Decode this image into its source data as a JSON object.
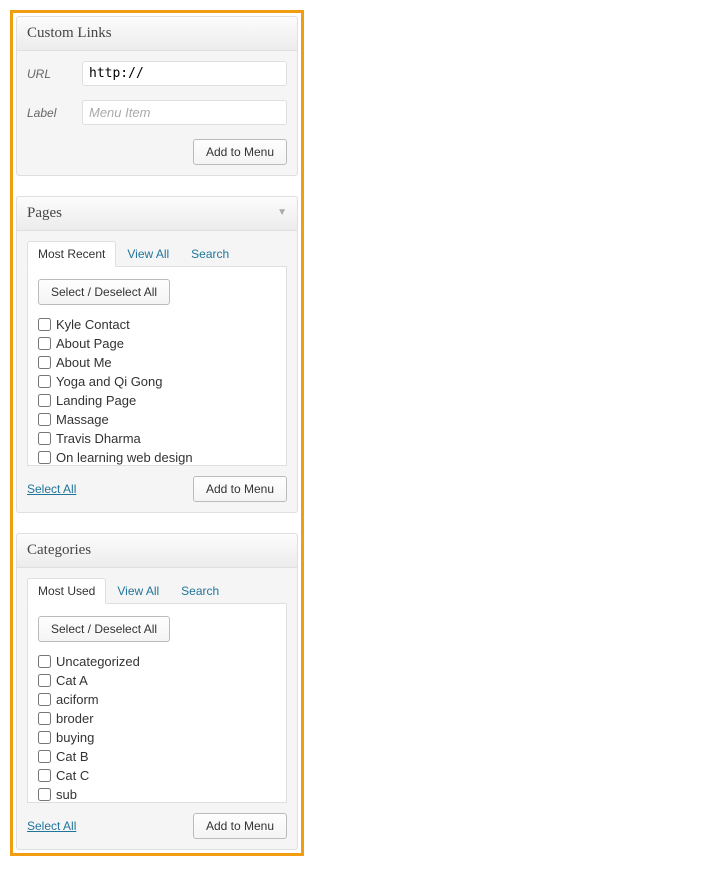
{
  "customLinks": {
    "title": "Custom Links",
    "urlLabel": "URL",
    "urlValue": "http://",
    "labelLabel": "Label",
    "labelPlaceholder": "Menu Item",
    "addButton": "Add to Menu"
  },
  "pages": {
    "title": "Pages",
    "tabs": {
      "mostRecent": "Most Recent",
      "viewAll": "View All",
      "search": "Search"
    },
    "selectDeselect": "Select / Deselect All",
    "items": [
      "Kyle Contact",
      "About Page",
      "About Me",
      "Yoga and Qi Gong",
      "Landing Page",
      "Massage",
      "Travis Dharma",
      "On learning web design"
    ],
    "selectAll": "Select All",
    "addButton": "Add to Menu"
  },
  "categories": {
    "title": "Categories",
    "tabs": {
      "mostUsed": "Most Used",
      "viewAll": "View All",
      "search": "Search"
    },
    "selectDeselect": "Select / Deselect All",
    "items": [
      "Uncategorized",
      "Cat A",
      "aciform",
      "broder",
      "buying",
      "Cat B",
      "Cat C",
      "sub"
    ],
    "selectAll": "Select All",
    "addButton": "Add to Menu"
  }
}
